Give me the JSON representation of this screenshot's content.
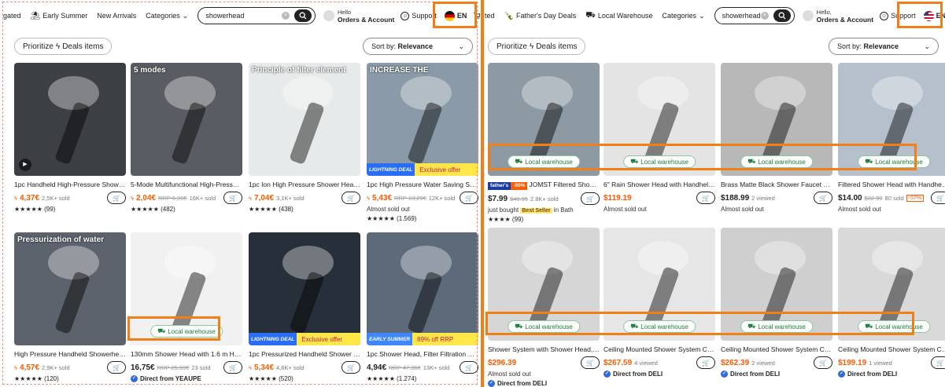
{
  "highlight_color": "#f07f1a",
  "panel0": {
    "nav": {
      "partial_first": "gated",
      "early_summer": "Early Summer",
      "new_arrivals": "New Arrivals",
      "categories": "Categories",
      "search_value": "showerhead",
      "hello": "Hello",
      "orders": "Orders & Account",
      "support": "Support",
      "lang": "EN"
    },
    "toolbar": {
      "prioritize": "Prioritize",
      "deals": "Deals items",
      "sort_prefix": "Sort by:",
      "sort_value": "Relevance"
    },
    "products": [
      {
        "title": "1pc Handheld High-Pressure Shower ...",
        "price": "4,37€",
        "rrp": "",
        "sold": "2,5K+ sold",
        "stars": "★★★★★",
        "reviews": "(99)",
        "bg": "#3c3f44",
        "caption": "",
        "play": true
      },
      {
        "title": "5-Mode Multifunctional High-Pressur...",
        "price": "2,04€",
        "rrp": "RRP 6,99€",
        "sold": "16K+ sold",
        "stars": "★★★★★",
        "reviews": "(482)",
        "bg": "#595d63",
        "caption": "5 modes"
      },
      {
        "title": "1pc Ion High Pressure Shower Head, ...",
        "price": "7,04€",
        "rrp": "",
        "sold": "3,1K+ sold",
        "stars": "★★★★★",
        "reviews": "(438)",
        "bg": "#e7eaea",
        "caption": "Principle of filter element"
      },
      {
        "title": "1pc High Pressure Water Saving Show...",
        "price": "5,43€",
        "rrp": "RRP 13,29€",
        "sold": "12K+ sold",
        "stars": "★★★★★",
        "reviews": "(1.569)",
        "bg": "#8a9aa8",
        "caption": "INCREASE THE",
        "note": "Almost sold out",
        "badge_left": "LIGHTNING DEAL",
        "badge_text": "Exclusive offer"
      },
      {
        "title": "High Pressure Handheld Showerhead ...",
        "price": "4,57€",
        "rrp": "",
        "sold": "2,9K+ sold",
        "stars": "★★★★★",
        "reviews": "(120)",
        "bg": "#5c636c",
        "caption": "Pressurization of water"
      },
      {
        "title": "130mm Shower Head with 1.6 m Hose...",
        "price": "16,75€",
        "rrp": "RRP 25,99€",
        "sold": "23 sold",
        "price_black": true,
        "direct": "Direct from YEAUPE",
        "bg": "#f1f1f1",
        "caption": "",
        "local": "Local warehouse"
      },
      {
        "title": "1pc Pressurized Handheld Shower He...",
        "price": "5,34€",
        "rrp": "",
        "sold": "4,6K+ sold",
        "stars": "★★★★★",
        "reviews": "(520)",
        "bg": "#27303a",
        "caption": "",
        "badge_left": "LIGHTNING DEAL",
        "badge_text": "Exclusive offer"
      },
      {
        "title": "1pc Shower Head, Filter Filtration Hig...",
        "price": "4,94€",
        "rrp": "RRP 47,36€",
        "sold": "13K+ sold",
        "price_black": true,
        "stars": "★★★★★",
        "reviews": "(1.274)",
        "bg": "#5d6a7a",
        "caption": "",
        "badge_left": "EARLY SUMMER",
        "badge_text": "89% off RRP",
        "badge_blue": true
      }
    ]
  },
  "panel1": {
    "nav": {
      "partial_first": "ted",
      "fathers_day": "Father's Day Deals",
      "local_wh": "Local Warehouse",
      "categories": "Categories",
      "search_value": "showerhead",
      "hello": "Hello,",
      "orders": "Orders & Account",
      "support": "Support",
      "lang": "EN"
    },
    "toolbar": {
      "prioritize": "Prioritize",
      "deals": "Deals items",
      "sort_prefix": "Sort by:",
      "sort_value": "Relevance"
    },
    "products": [
      {
        "title": "JOMST Filtered Shower H...",
        "title_badge": "father's",
        "title_disc": "-80%",
        "price": "$7.99",
        "rrp": "$40.95",
        "sold": "2.8K+ sold",
        "price_black": true,
        "note": "just bought",
        "best": "Best Seller",
        "best_suffix": "in Bath",
        "stars": "★★★★",
        "reviews": "(99)",
        "bg": "#8d99a3",
        "local": "Local warehouse"
      },
      {
        "title": "6\" Rain Shower Head with Handheld ...",
        "price": "$119.19",
        "rrp": "",
        "sold": "",
        "note": "Almost sold out",
        "bg": "#e4e4e4",
        "local": "Local warehouse"
      },
      {
        "title": "Brass Matte Black Shower Faucet Set ...",
        "price": "$188.99",
        "rrp": "",
        "sold": "2 viewed",
        "price_black": true,
        "note": "Almost sold out",
        "bg": "#b8b8b8",
        "local": "Local warehouse"
      },
      {
        "title": "Filtered Shower Head with Handheld, ...",
        "price": "$14.00",
        "rrp": "$32.99",
        "sold": "80 sold",
        "disc": "-57%",
        "price_black": true,
        "note": "Almost sold out",
        "bg": "#b5c0cc",
        "local": "Local warehouse"
      },
      {
        "title": "Shower System with Shower Head, H...",
        "price": "$296.39",
        "rrp": "",
        "sold": "",
        "note": "Almost sold out",
        "direct": "Direct from DELI",
        "bg": "#d6d6d6",
        "local": "Local warehouse"
      },
      {
        "title": "Ceiling Mounted Shower System Com...",
        "price": "$267.59",
        "rrp": "",
        "sold": "4 viewed",
        "direct": "Direct from DELI",
        "bg": "#e6e6e6",
        "local": "Local warehouse"
      },
      {
        "title": "Ceiling Mounted Shower System Com...",
        "price": "$262.39",
        "rrp": "",
        "sold": "2 viewed",
        "direct": "Direct from DELI",
        "bg": "#cfcfcf",
        "local": "Local warehouse"
      },
      {
        "title": "Ceiling Mounted Shower System Com...",
        "price": "$199.19",
        "rrp": "",
        "sold": "1 viewed",
        "direct": "Direct from DELI",
        "bg": "#d9d9d9",
        "local": "Local warehouse"
      }
    ]
  }
}
